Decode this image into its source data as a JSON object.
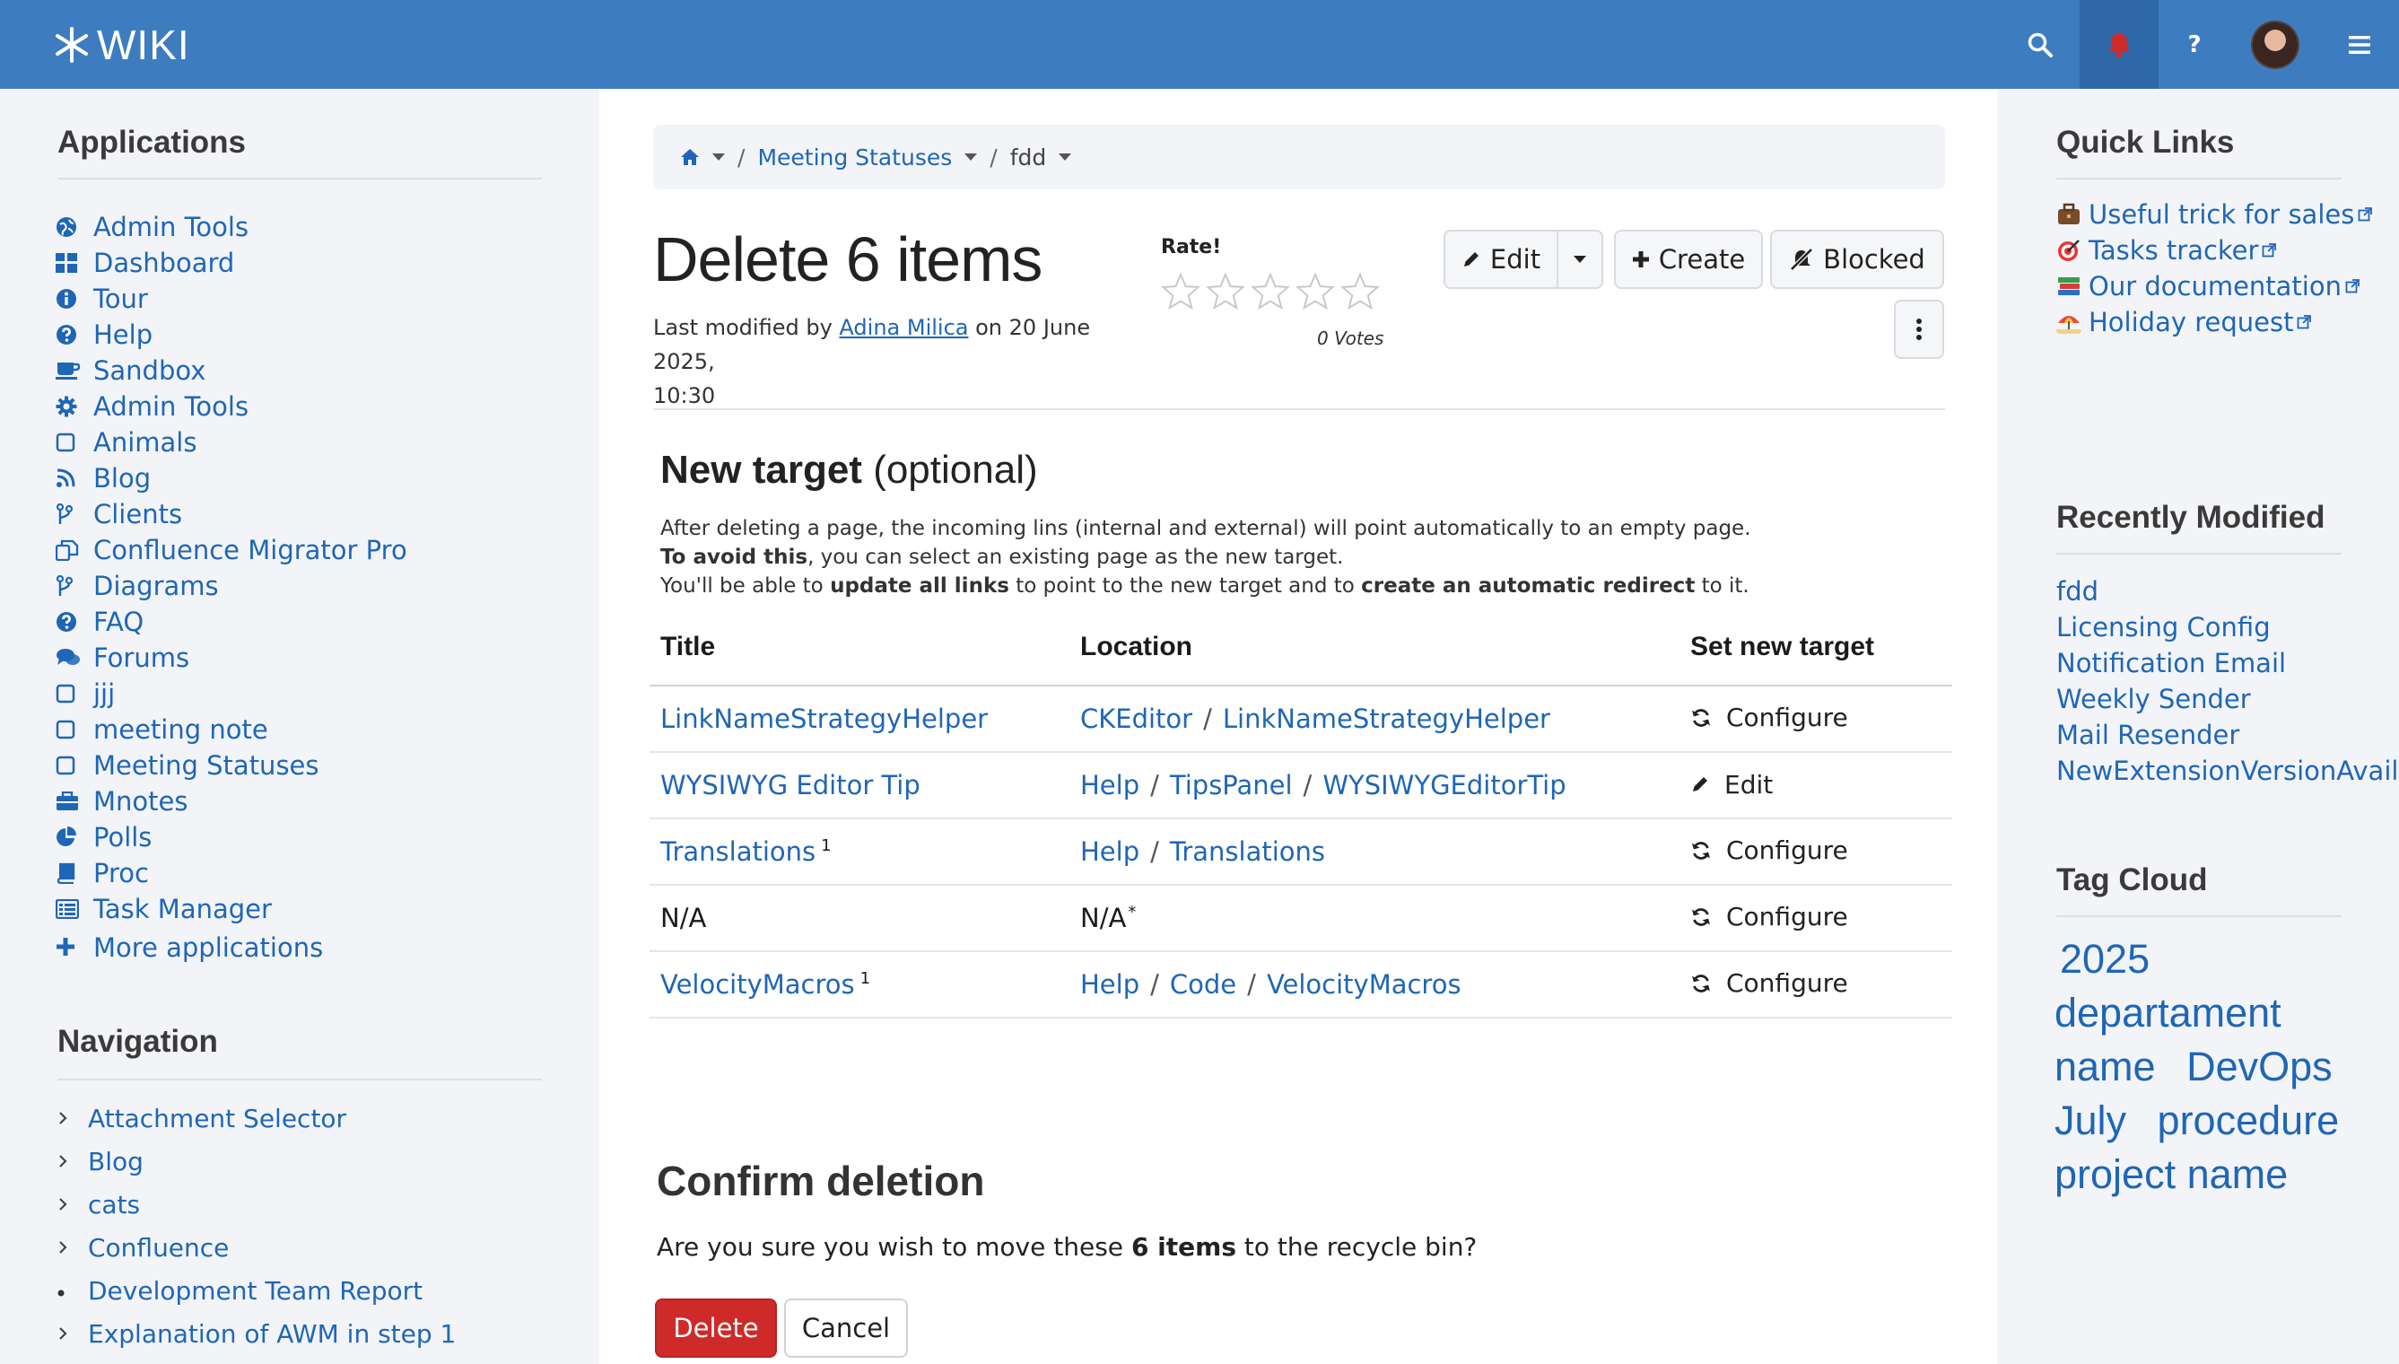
{
  "topbar": {
    "logo_text": "WIKI",
    "icons": [
      "search-icon",
      "bell-icon",
      "help-icon",
      "avatar",
      "menu-icon"
    ],
    "brand_color": "#3e7cc0",
    "notification_color": "#d02b2b"
  },
  "left": {
    "applications_title": "Applications",
    "apps": [
      {
        "label": "Admin Tools",
        "icon": "globe-icon"
      },
      {
        "label": "Dashboard",
        "icon": "grid-icon"
      },
      {
        "label": "Tour",
        "icon": "info-icon"
      },
      {
        "label": "Help",
        "icon": "question-icon"
      },
      {
        "label": "Sandbox",
        "icon": "cup-icon"
      },
      {
        "label": "Admin Tools",
        "icon": "gear-icon"
      },
      {
        "label": "Animals",
        "icon": "square-icon"
      },
      {
        "label": "Blog",
        "icon": "rss-icon"
      },
      {
        "label": "Clients",
        "icon": "branch-icon"
      },
      {
        "label": "Confluence Migrator Pro",
        "icon": "copy-icon"
      },
      {
        "label": "Diagrams",
        "icon": "branch-icon"
      },
      {
        "label": "FAQ",
        "icon": "question-icon"
      },
      {
        "label": "Forums",
        "icon": "comments-icon"
      },
      {
        "label": "jjj",
        "icon": "square-icon"
      },
      {
        "label": "meeting note",
        "icon": "square-icon"
      },
      {
        "label": "Meeting Statuses",
        "icon": "square-icon"
      },
      {
        "label": "Mnotes",
        "icon": "briefcase-icon"
      },
      {
        "label": "Polls",
        "icon": "pie-icon"
      },
      {
        "label": "Proc",
        "icon": "book-icon"
      },
      {
        "label": "Task Manager",
        "icon": "list-icon"
      }
    ],
    "more_apps": "More applications",
    "navigation_title": "Navigation",
    "nav": [
      {
        "label": "Attachment Selector",
        "marker": "chevron"
      },
      {
        "label": "Blog",
        "marker": "chevron"
      },
      {
        "label": "cats",
        "marker": "chevron"
      },
      {
        "label": "Confluence",
        "marker": "chevron"
      },
      {
        "label": "Development Team Report",
        "marker": "dot"
      },
      {
        "label": "Explanation of AWM in step 1",
        "marker": "chevron"
      }
    ]
  },
  "main": {
    "breadcrumb": {
      "home_icon": "home-icon",
      "item1": "Meeting Statuses",
      "item2": "fdd",
      "separator": "/"
    },
    "title": "Delete 6 items",
    "modified_prefix": "Last modified by",
    "modified_user": "Adina Milica",
    "modified_suffix": "on 20 June 2025,",
    "modified_time": "10:30",
    "rate_label": "Rate!",
    "votes": "0 Votes",
    "buttons": {
      "edit": "Edit",
      "create": "Create",
      "blocked": "Blocked"
    },
    "new_target_title": "New target",
    "new_target_optional": "(optional)",
    "desc": {
      "line1": "After deleting a page, the incoming lins (internal and external) will point automatically to an empty page.",
      "line2_bold": "To avoid this",
      "line2_rest": ", you can select an existing page as the new target.",
      "line3_a": "You'll be able to ",
      "line3_b": "update all links",
      "line3_c": " to point to the new target and to ",
      "line3_d": "create an automatic redirect",
      "line3_e": " to it."
    },
    "table": {
      "headers": [
        "Title",
        "Location",
        "Set new target"
      ],
      "rows": [
        {
          "title": "LinkNameStrategyHelper",
          "title_sup": "",
          "location": [
            "CKEditor",
            "LinkNameStrategyHelper"
          ],
          "location_sup": "",
          "action": "Configure",
          "action_icon": "refresh-icon"
        },
        {
          "title": "WYSIWYG Editor Tip",
          "title_sup": "",
          "location": [
            "Help",
            "TipsPanel",
            "WYSIWYGEditorTip"
          ],
          "location_sup": "",
          "action": "Edit",
          "action_icon": "pencil-icon"
        },
        {
          "title": "Translations",
          "title_sup": "1",
          "location": [
            "Help",
            "Translations"
          ],
          "location_sup": "",
          "action": "Configure",
          "action_icon": "refresh-icon"
        },
        {
          "title": "N/A",
          "title_sup": "",
          "location": [
            "N/A"
          ],
          "location_sup": "*",
          "action": "Configure",
          "action_icon": "refresh-icon"
        },
        {
          "title": "VelocityMacros",
          "title_sup": "1",
          "location": [
            "Help",
            "Code",
            "VelocityMacros"
          ],
          "location_sup": "",
          "action": "Configure",
          "action_icon": "refresh-icon"
        }
      ]
    },
    "confirm_title": "Confirm deletion",
    "confirm_prefix": "Are you sure you wish to move these ",
    "confirm_bold": "6 items",
    "confirm_suffix": " to the recycle bin?",
    "delete_label": "Delete",
    "cancel_label": "Cancel",
    "delete_color": "#cf2a2a"
  },
  "right": {
    "quick_links_title": "Quick Links",
    "quick_links": [
      {
        "label": "Useful trick for sales",
        "icon": "briefcase-emoji"
      },
      {
        "label": "Tasks tracker",
        "icon": "target-emoji"
      },
      {
        "label": "Our documentation",
        "icon": "books-emoji"
      },
      {
        "label": "Holiday request",
        "icon": "beach-emoji"
      }
    ],
    "recently_modified_title": "Recently Modified",
    "recent": [
      "fdd",
      "Licensing Config",
      "Notification Email",
      "Weekly Sender",
      "Mail Resender",
      "NewExtensionVersionAvail"
    ],
    "tag_cloud_title": "Tag Cloud",
    "tags": [
      "2025",
      "departament",
      "name",
      "DevOps",
      "July",
      "procedure",
      "project name"
    ]
  }
}
